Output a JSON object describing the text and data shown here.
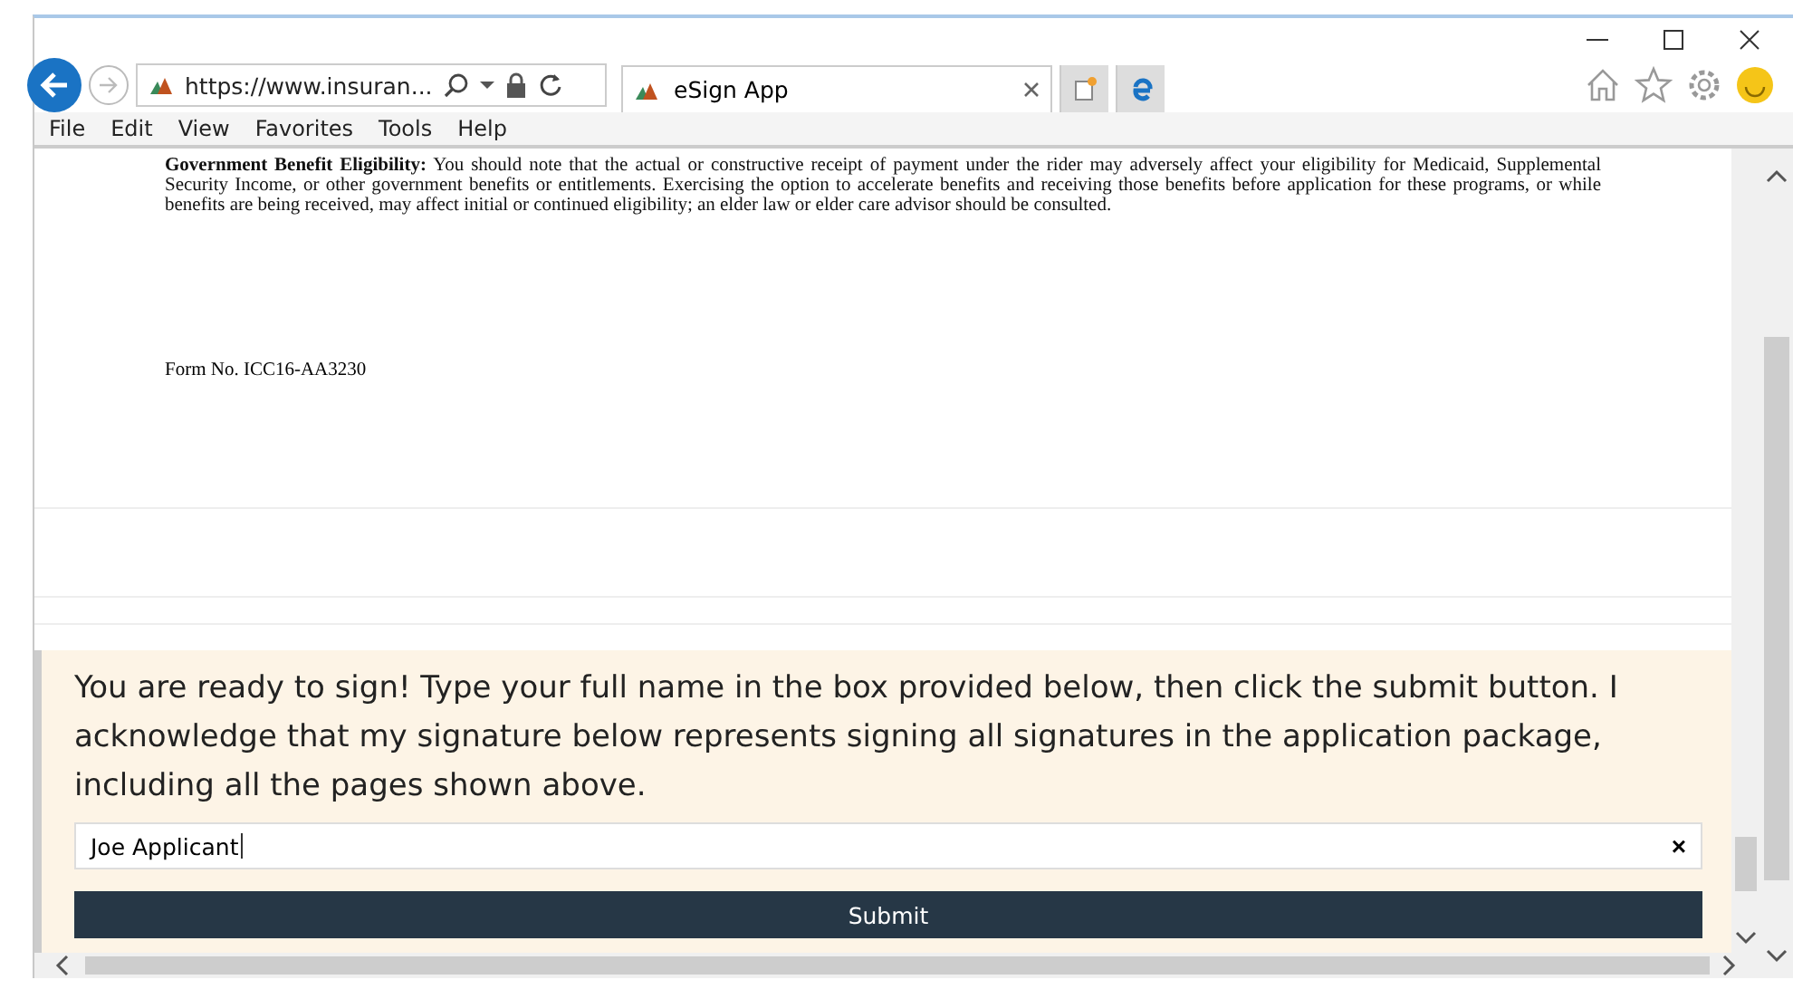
{
  "browser": {
    "address": "https://www.insuran...",
    "tab_title": "eSign App",
    "menu": [
      "File",
      "Edit",
      "View",
      "Favorites",
      "Tools",
      "Help"
    ]
  },
  "document": {
    "paragraph": "**Government Benefit Eligibility:** You should note that the actual or constructive receipt of payment under the rider may adversely affect your eligibility for Medicaid, Supplemental Security Income, or other government benefits or entitlements. Exercising the option to accelerate benefits and receiving those benefits before application for these programs, or while benefits are being received, may affect initial or continued eligibility; an elder law or elder care advisor should be consulted.",
    "form_number": "Form No. ICC16-AA3230"
  },
  "sign_panel": {
    "instructions": "You are ready to sign! Type your full name in the box provided below, then click the submit button. I acknowledge that my signature below represents signing all signatures in the application package, including all the pages shown above.",
    "name_value": "Joe Applicant",
    "clear_label": "×",
    "submit_label": "Submit"
  }
}
